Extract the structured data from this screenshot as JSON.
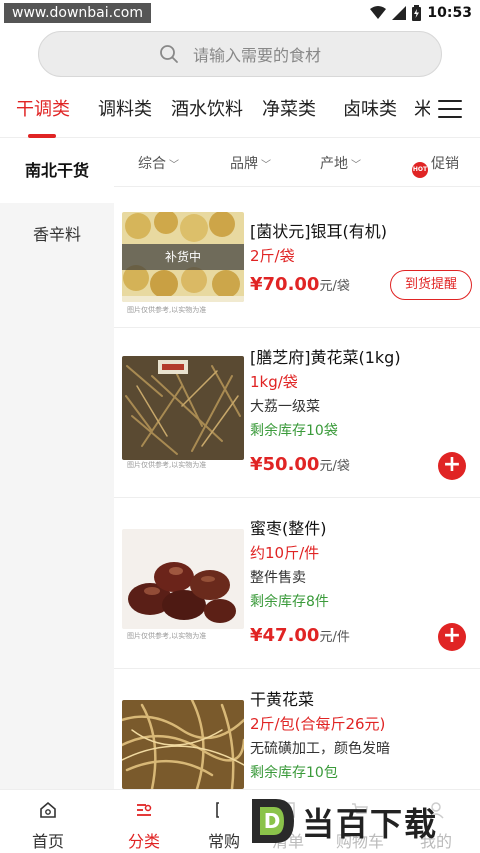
{
  "status_bar": {
    "watermark": "www.downbai.com",
    "time": "10:53",
    "icons": [
      "wifi-icon",
      "signal-icon",
      "battery-icon"
    ]
  },
  "search": {
    "placeholder": "请输入需要的食材"
  },
  "top_tabs": [
    {
      "label": "干调类",
      "active": true
    },
    {
      "label": "调料类"
    },
    {
      "label": "酒水饮料"
    },
    {
      "label": "净菜类"
    },
    {
      "label": "卤味类"
    },
    {
      "label": "米"
    }
  ],
  "sidebar": {
    "items": [
      {
        "label": "南北干货",
        "active": true
      },
      {
        "label": "香辛料"
      }
    ]
  },
  "filters": {
    "sort": "综合",
    "brand": "品牌",
    "origin": "产地",
    "promo": "促销",
    "hot_badge": "HOT"
  },
  "products": [
    {
      "name": "[菌状元]银耳(有机)",
      "spec": "2斤/袋",
      "price": "¥70.00",
      "unit": "元/袋",
      "overlay": "补货中",
      "note": "图片仅供参考,以实物为准",
      "action": "到货提醒"
    },
    {
      "name": "[膳芝府]黄花菜(1kg)",
      "spec": "1kg/袋",
      "desc": "大荔一级菜",
      "stock": "剩余库存10袋",
      "price": "¥50.00",
      "unit": "元/袋",
      "note": "图片仅供参考,以实物为准",
      "add_symbol": "+"
    },
    {
      "name": "蜜枣(整件)",
      "spec": "约10斤/件",
      "desc": "整件售卖",
      "stock": "剩余库存8件",
      "price": "¥47.00",
      "unit": "元/件",
      "note": "图片仅供参考,以实物为准",
      "add_symbol": "+"
    },
    {
      "name": "干黄花菜",
      "spec": "2斤/包(合每斤26元)",
      "desc": "无硫磺加工，颜色发暗",
      "stock": "剩余库存10包"
    }
  ],
  "bottom_nav": [
    {
      "label": "首页",
      "icon": "home-icon"
    },
    {
      "label": "分类",
      "icon": "category-icon",
      "active": true
    },
    {
      "label": "常购",
      "icon": "frequent-icon"
    },
    {
      "label": "清单",
      "icon": "list-icon"
    },
    {
      "label": "购物车",
      "icon": "cart-icon"
    },
    {
      "label": "我的",
      "icon": "user-icon"
    }
  ],
  "watermark_logo": {
    "letter": "D",
    "text": "当百下载"
  },
  "colors": {
    "accent": "#e02424",
    "stock_green": "#3a9a3a"
  }
}
